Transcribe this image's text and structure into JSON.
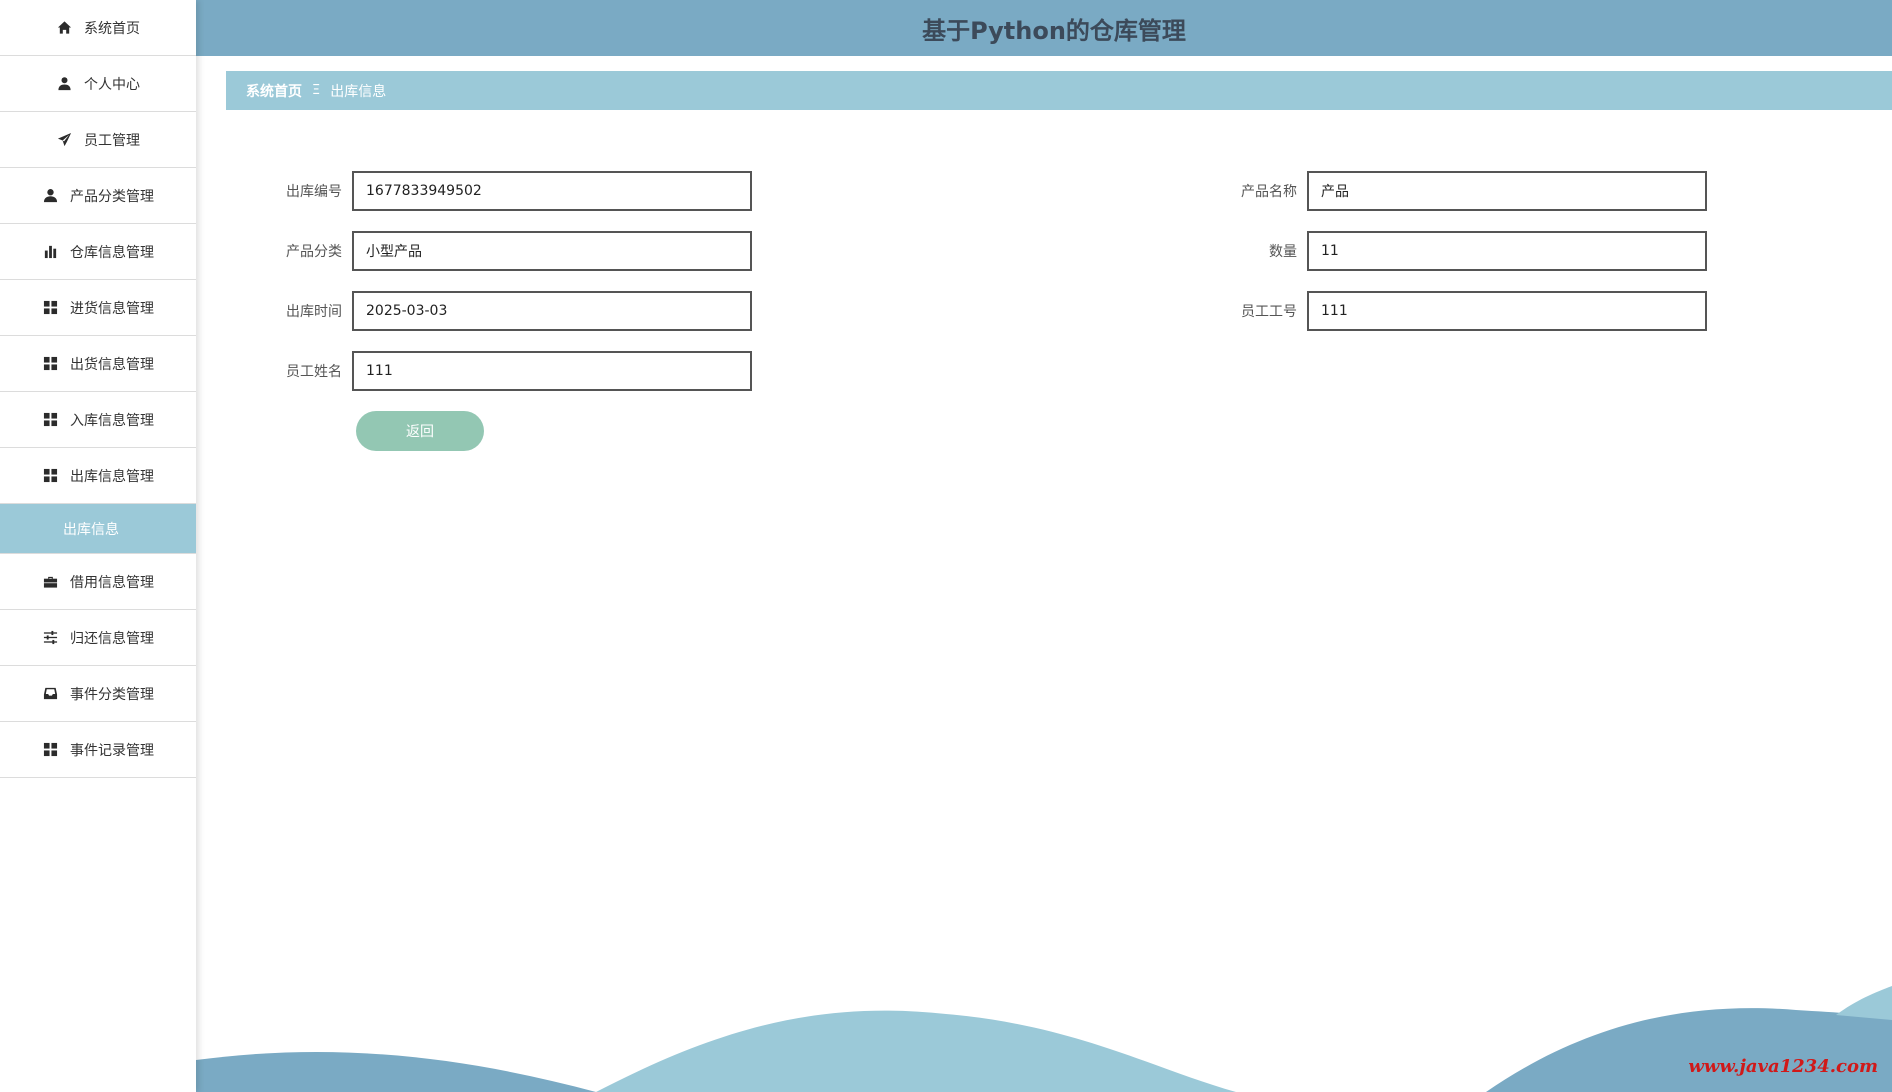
{
  "header": {
    "title": "基于Python的仓库管理"
  },
  "sidebar": {
    "items": [
      {
        "label": "系统首页",
        "icon": "home-icon"
      },
      {
        "label": "个人中心",
        "icon": "user-icon"
      },
      {
        "label": "员工管理",
        "icon": "paper-plane-icon"
      },
      {
        "label": "产品分类管理",
        "icon": "user-icon"
      },
      {
        "label": "仓库信息管理",
        "icon": "bar-chart-icon"
      },
      {
        "label": "进货信息管理",
        "icon": "grid-icon"
      },
      {
        "label": "出货信息管理",
        "icon": "grid-icon"
      },
      {
        "label": "入库信息管理",
        "icon": "grid-icon"
      },
      {
        "label": "出库信息管理",
        "icon": "grid-icon"
      },
      {
        "label": "借用信息管理",
        "icon": "briefcase-icon"
      },
      {
        "label": "归还信息管理",
        "icon": "sliders-icon"
      },
      {
        "label": "事件分类管理",
        "icon": "inbox-icon"
      },
      {
        "label": "事件记录管理",
        "icon": "grid-icon"
      }
    ],
    "active_sub": "出库信息"
  },
  "breadcrumb": {
    "home": "系统首页",
    "separator": "Ξ",
    "current": "出库信息"
  },
  "form": {
    "outbound_no_label": "出库编号",
    "outbound_no_value": "1677833949502",
    "product_name_label": "产品名称",
    "product_name_value": "产品",
    "product_category_label": "产品分类",
    "product_category_value": "小型产品",
    "quantity_label": "数量",
    "quantity_value": "11",
    "outbound_time_label": "出库时间",
    "outbound_time_value": "2025-03-03",
    "employee_id_label": "员工工号",
    "employee_id_value": "111",
    "employee_name_label": "员工姓名",
    "employee_name_value": "111",
    "back_label": "返回"
  },
  "watermark": "www.java1234.com",
  "colors": {
    "header_bg": "#7aaac4",
    "breadcrumb_bg": "#9bc9d8",
    "active_item_bg": "#9bc9d8",
    "button_bg": "#93c7b3",
    "watermark": "#d01919"
  }
}
